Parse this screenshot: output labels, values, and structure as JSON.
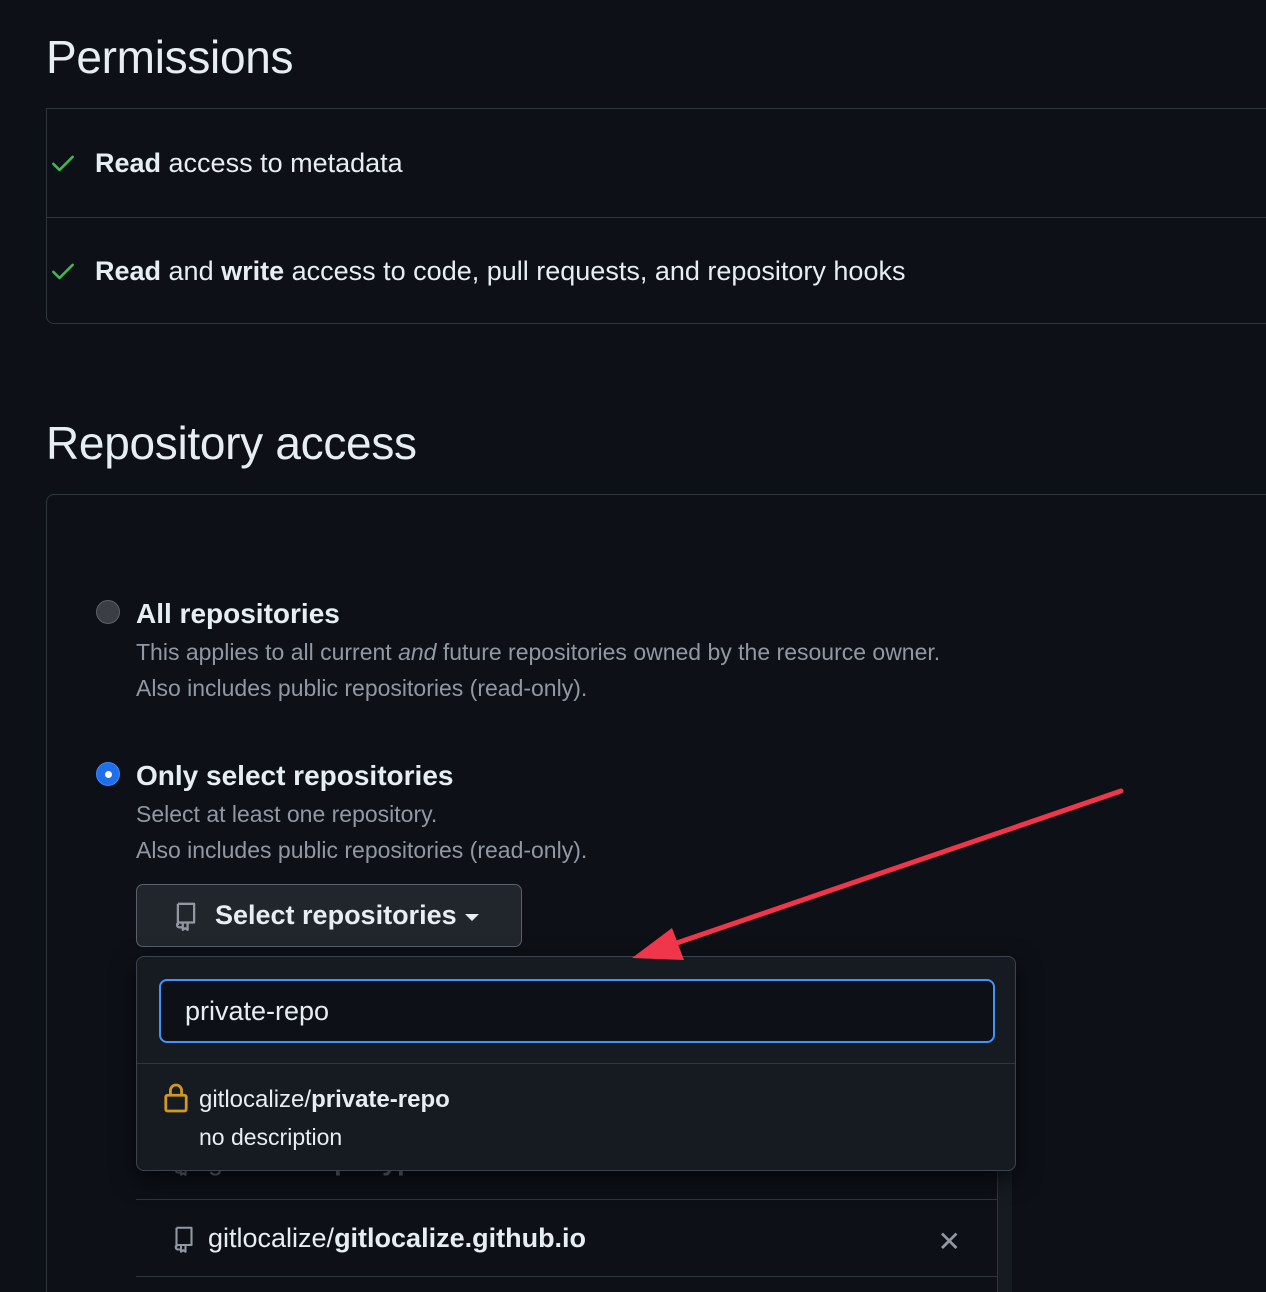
{
  "permissions": {
    "title": "Permissions",
    "items": [
      {
        "bold1": "Read",
        "mid": "",
        "bold2": "",
        "rest": " access to metadata"
      },
      {
        "bold1": "Read",
        "mid": " and ",
        "bold2": "write",
        "rest": " access to code, pull requests, and repository hooks"
      }
    ]
  },
  "repository_access": {
    "title": "Repository access",
    "options": [
      {
        "label": "All repositories",
        "desc_pre": "This applies to all current ",
        "desc_em": "and",
        "desc_post": " future repositories owned by the resource owner.",
        "desc2": "Also includes public repositories (read-only).",
        "selected": false
      },
      {
        "label": "Only select repositories",
        "desc1": "Select at least one repository.",
        "desc2": "Also includes public repositories (read-only).",
        "selected": true
      }
    ],
    "select_button_label": "Select repositories",
    "dropdown": {
      "filter_value": "private-repo",
      "result": {
        "owner": "gitlocalize/",
        "repo": "private-repo",
        "description": "no description"
      }
    },
    "selected_list": [
      {
        "owner": "gitlocalize/",
        "repo": "platypus"
      },
      {
        "owner": "gitlocalize/",
        "repo": "gitlocalize.github.io",
        "remove_label": "✕"
      }
    ]
  },
  "colors": {
    "check": "#3fb950",
    "accent": "#4493f8",
    "lock": "#d29922",
    "annotation_arrow": "#f0364b"
  }
}
